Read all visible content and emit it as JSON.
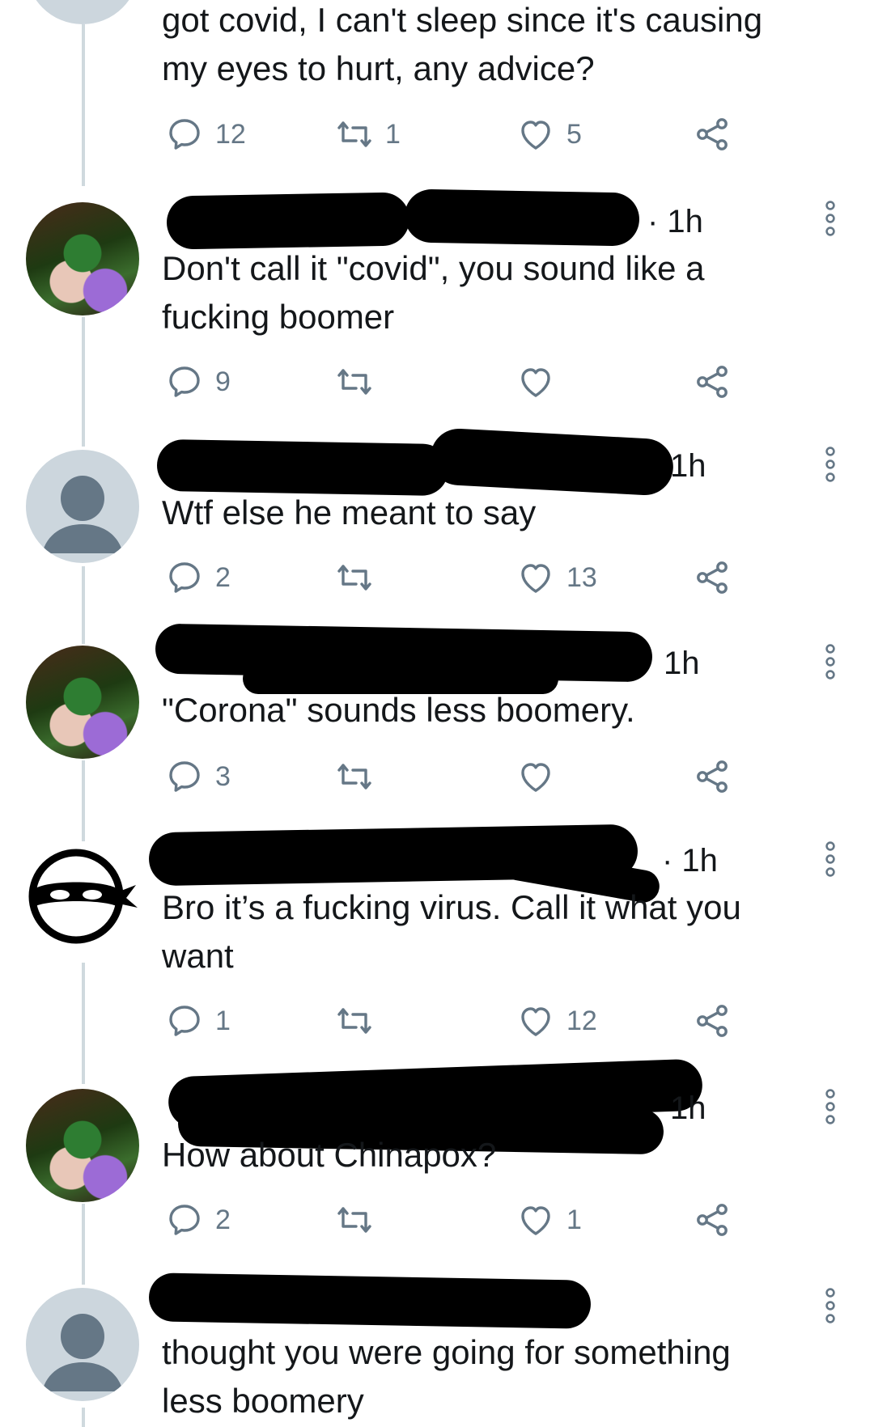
{
  "tweets": [
    {
      "avatar": "",
      "time": "",
      "text": "got covid, I can't sleep since it's causing\nmy eyes to hurt, any advice?",
      "replies": "12",
      "retweets": "1",
      "likes": "5"
    },
    {
      "avatar": "profile-photo",
      "time": "· 1h",
      "text": "Don't call it \"covid\", you sound like a\nfucking boomer",
      "replies": "9",
      "retweets": "",
      "likes": ""
    },
    {
      "avatar": "default-avatar",
      "time": "1h",
      "text": "Wtf else he meant to say",
      "replies": "2",
      "retweets": "",
      "likes": "13"
    },
    {
      "avatar": "profile-photo",
      "time": "1h",
      "text": "\"Corona\" sounds less boomery.",
      "replies": "3",
      "retweets": "",
      "likes": ""
    },
    {
      "avatar": "ninja-mask",
      "time": "· 1h",
      "text": "Bro it’s a fucking virus. Call it what you\nwant",
      "replies": "1",
      "retweets": "",
      "likes": "12"
    },
    {
      "avatar": "profile-photo",
      "time": "1h",
      "text": "How about Chinapox?",
      "replies": "2",
      "retweets": "",
      "likes": "1"
    },
    {
      "avatar": "default-avatar",
      "time": "",
      "text": "thought you were going for something\nless boomery",
      "replies": "",
      "retweets": "",
      "likes": ""
    }
  ],
  "icons": {
    "reply": "reply-icon",
    "retweet": "retweet-icon",
    "like": "heart-icon",
    "share": "share-icon",
    "more": "more-options-icon"
  },
  "colors": {
    "icon_gray": "#657786",
    "thread_line": "#cfd9de",
    "default_avatar_bg": "#ccd6dd",
    "redaction": "#000000"
  }
}
